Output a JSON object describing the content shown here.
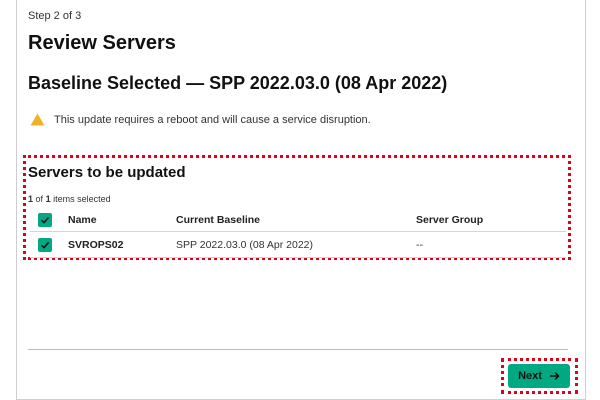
{
  "wizard": {
    "step_label": "Step 2 of 3",
    "title": "Review Servers",
    "baseline_heading": "Baseline Selected — SPP 2022.03.0 (08 Apr 2022)"
  },
  "warning": {
    "icon": "warning-triangle-icon",
    "color": "#f0b323",
    "text": "This update requires a reboot and will cause a service disruption."
  },
  "servers": {
    "heading": "Servers to be updated",
    "selected_count": "1",
    "of_text": "of",
    "total_count": "1",
    "items_selected_text": "items selected",
    "columns": {
      "name": "Name",
      "current_baseline": "Current Baseline",
      "server_group": "Server Group"
    },
    "rows": [
      {
        "checked": true,
        "name": "SVROPS02",
        "current_baseline": "SPP 2022.03.0 (08 Apr 2022)",
        "server_group": "--"
      }
    ]
  },
  "footer": {
    "next_label": "Next",
    "next_icon": "arrow-right-icon"
  },
  "colors": {
    "accent": "#01a982",
    "highlight": "#e0001a"
  }
}
